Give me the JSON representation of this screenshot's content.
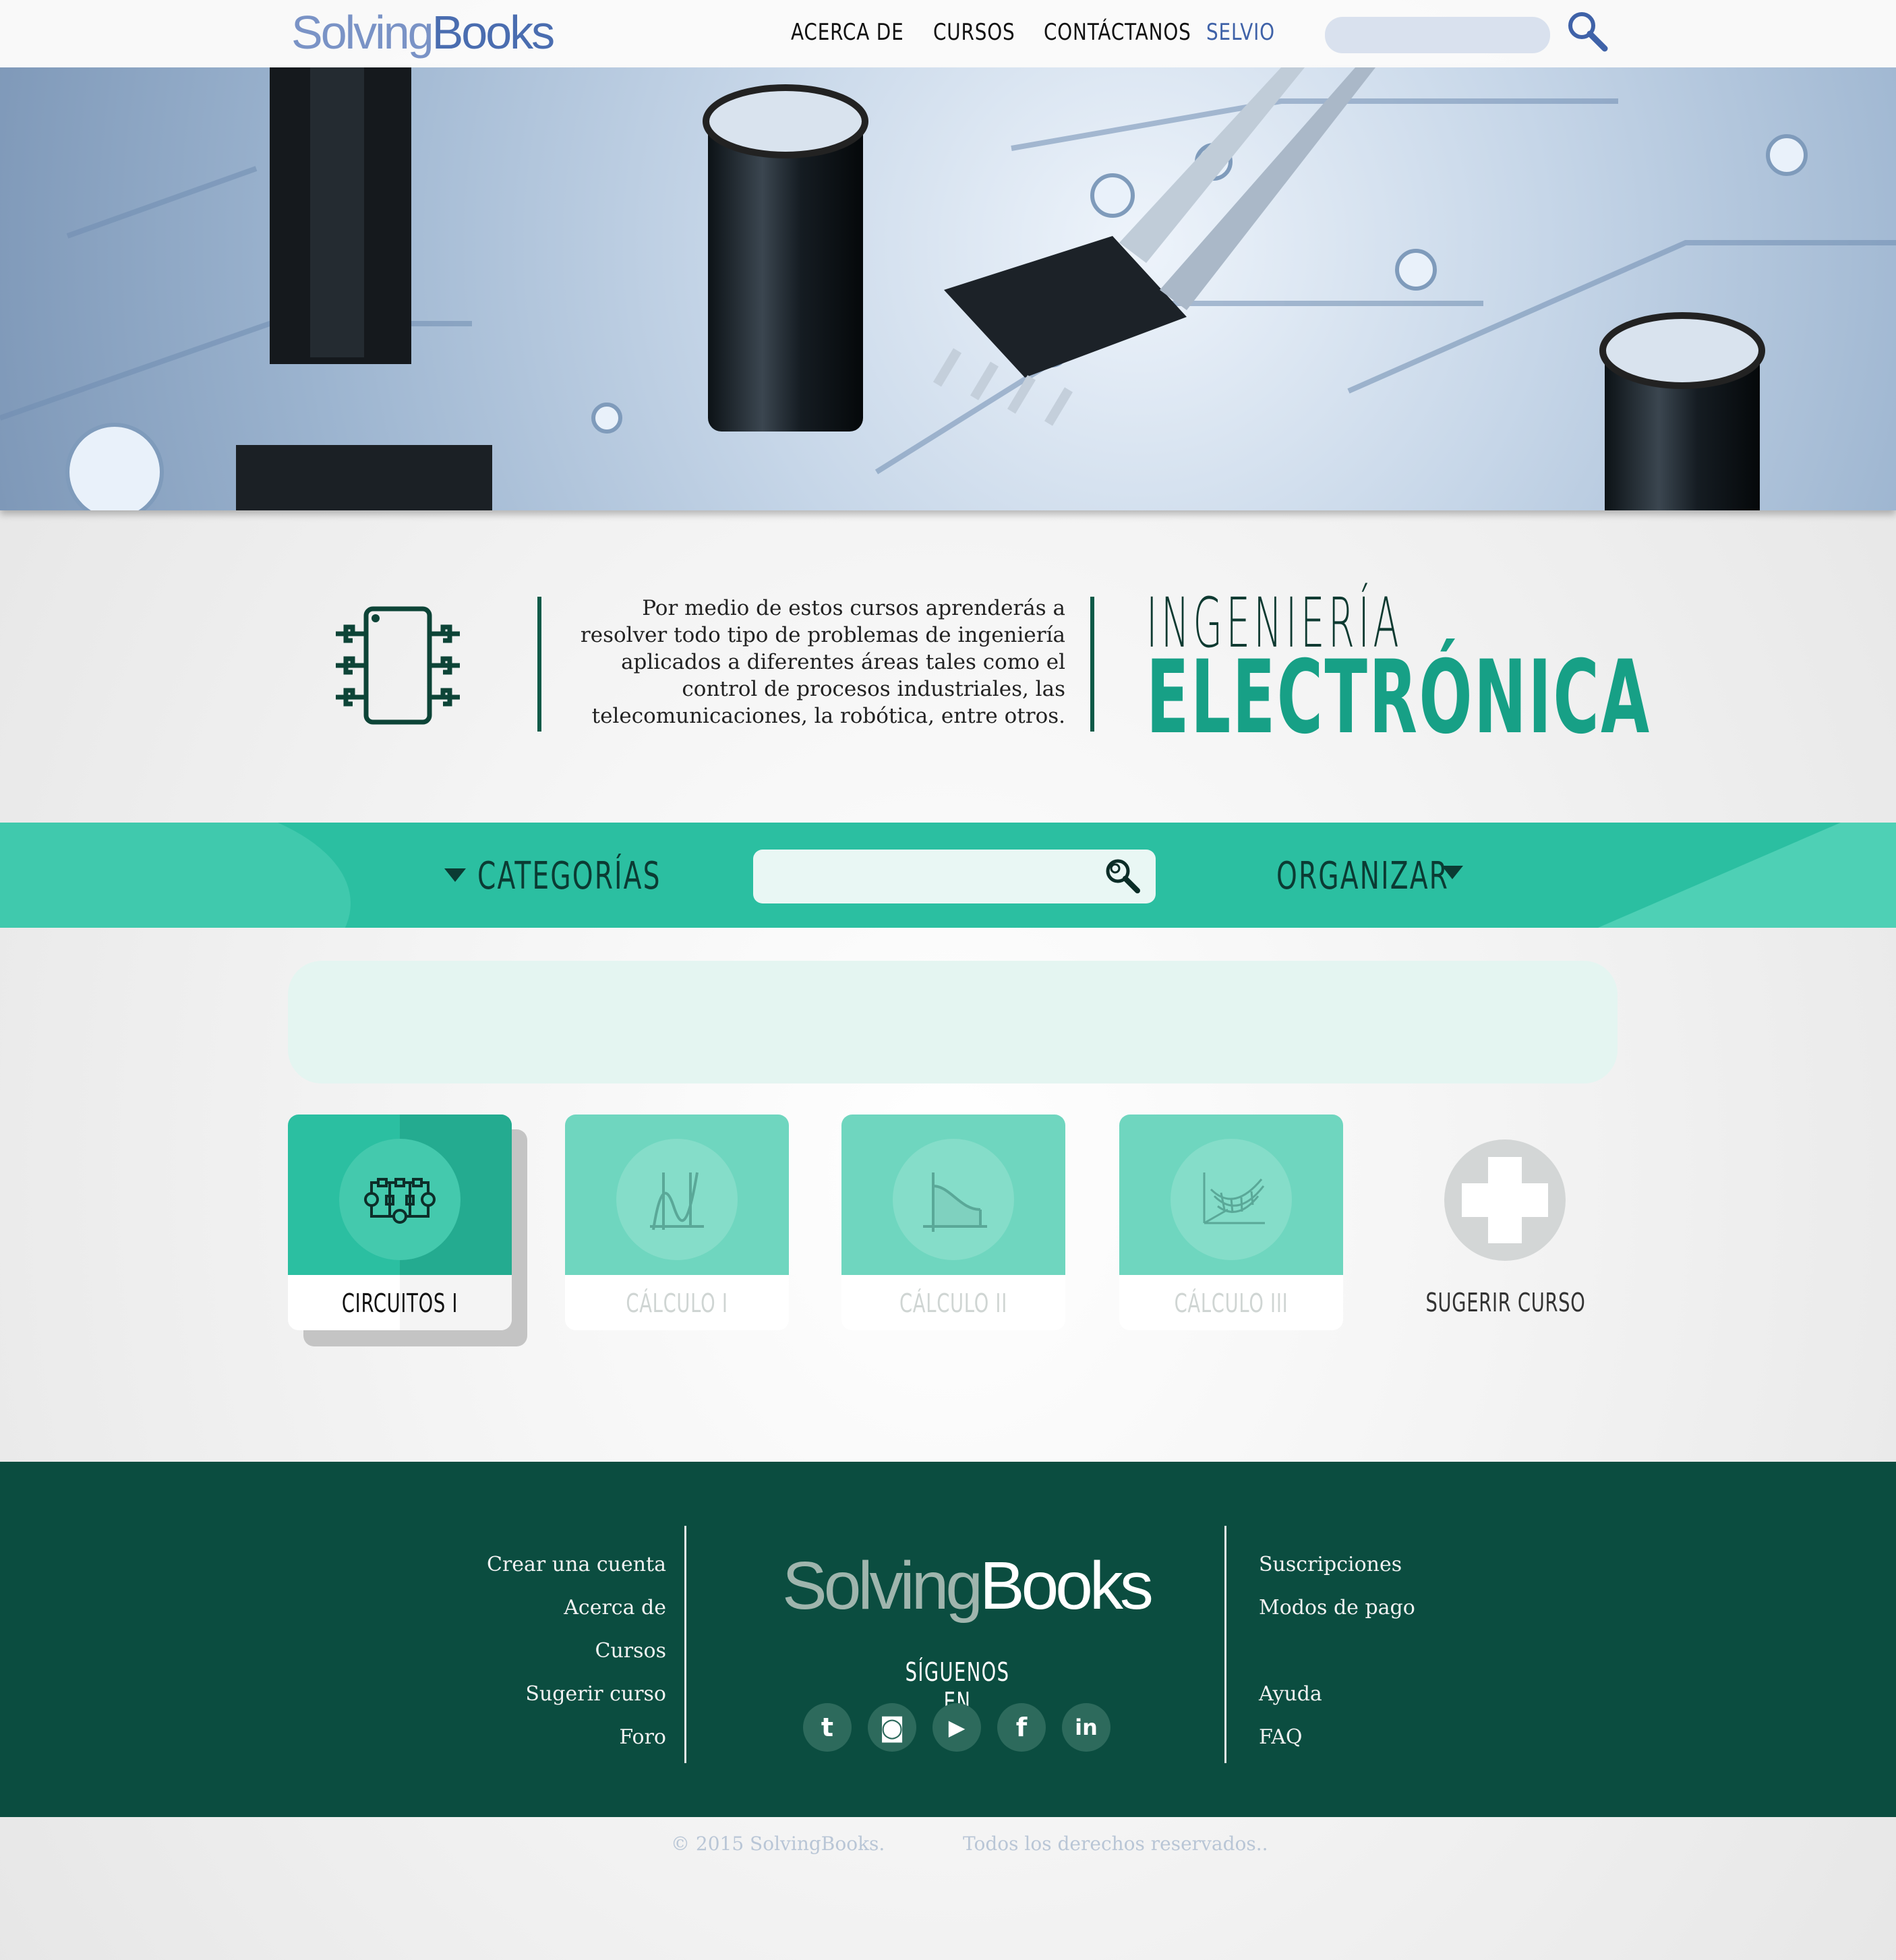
{
  "header": {
    "logo": {
      "part1": "Solving",
      "part2": "Books"
    },
    "nav": [
      {
        "label": "ACERCA DE"
      },
      {
        "label": "CURSOS"
      },
      {
        "label": "CONTÁCTANOS"
      },
      {
        "label": "SELVIO"
      }
    ],
    "search_value": ""
  },
  "intro": {
    "description": "Por medio de estos cursos aprenderás a resolver todo tipo de problemas de ingeniería aplicados a diferentes áreas tales como el control de procesos industriales, las telecomunicaciones, la robótica, entre otros.",
    "title_line1": "INGENIERÍA",
    "title_line2": "ELECTRÓNICA"
  },
  "filter_bar": {
    "categories_label": "CATEGORÍAS",
    "organize_label": "ORGANIZAR",
    "search_value": ""
  },
  "courses": [
    {
      "label": "CIRCUITOS I",
      "icon": "circuit-icon",
      "active": true
    },
    {
      "label": "CÁLCULO I",
      "icon": "function-graph-icon",
      "active": false
    },
    {
      "label": "CÁLCULO II",
      "icon": "area-curve-icon",
      "active": false
    },
    {
      "label": "CÁLCULO III",
      "icon": "surface-3d-icon",
      "active": false
    }
  ],
  "suggest": {
    "label": "SUGERIR CURSO",
    "icon": "plus-icon"
  },
  "footer": {
    "left_links": [
      "Crear una cuenta",
      "Acerca de",
      "Cursos",
      "Sugerir curso",
      "Foro"
    ],
    "right_links": [
      "Suscripciones",
      "Modos de pago",
      "Ayuda",
      "FAQ"
    ],
    "logo": {
      "part1": "Solving",
      "part2": "Books"
    },
    "follow_label": "SÍGUENOS EN",
    "social": [
      {
        "name": "twitter-icon",
        "glyph": "t"
      },
      {
        "name": "instagram-icon",
        "glyph": "◙"
      },
      {
        "name": "youtube-icon",
        "glyph": "▶"
      },
      {
        "name": "facebook-icon",
        "glyph": "f"
      },
      {
        "name": "linkedin-icon",
        "glyph": "in"
      }
    ],
    "copyright": "© 2015 SolvingBooks.",
    "rights": "Todos los derechos reservados.."
  },
  "colors": {
    "primary_teal": "#2bbfa1",
    "dark_green": "#0b4d40",
    "title_teal": "#17a086",
    "nav_accent": "#4a6db0"
  }
}
